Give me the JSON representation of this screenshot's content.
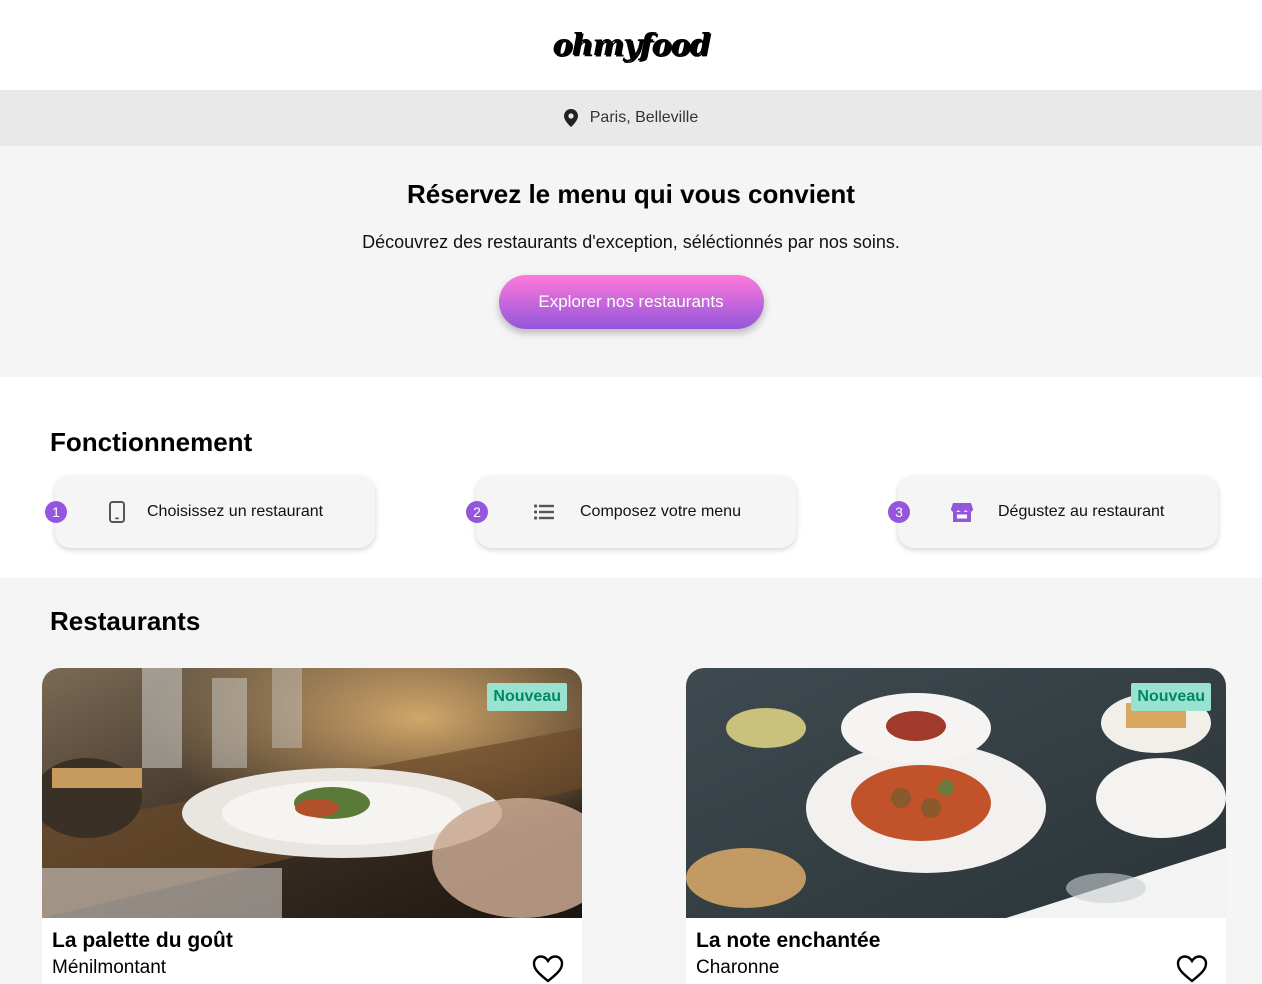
{
  "header": {
    "logo": "ohmyfood"
  },
  "location": {
    "icon": "map-pin-icon",
    "text": "Paris, Belleville"
  },
  "hero": {
    "title": "Réservez le menu qui vous convient",
    "subtitle": "Découvrez des restaurants d'exception, séléctionnés par nos soins.",
    "cta_label": "Explorer nos restaurants"
  },
  "how": {
    "title": "Fonctionnement",
    "steps": [
      {
        "number": "1",
        "icon": "mobile-phone-icon",
        "label": "Choisissez un restaurant"
      },
      {
        "number": "2",
        "icon": "list-icon",
        "label": "Composez votre menu"
      },
      {
        "number": "3",
        "icon": "store-icon",
        "label": "Dégustez au restaurant"
      }
    ]
  },
  "restaurants": {
    "title": "Restaurants",
    "items": [
      {
        "name": "La palette du goût",
        "area": "Ménilmontant",
        "badge": "Nouveau",
        "photo": "restaurant-table-plates-photo"
      },
      {
        "name": "La note enchantée",
        "area": "Charonne",
        "badge": "Nouveau",
        "photo": "plates-from-above-photo"
      }
    ]
  },
  "colors": {
    "accent_purple": "#9356dc",
    "accent_pink": "#ff79da",
    "badge_bg": "#99e2d0",
    "badge_text": "#008766"
  }
}
